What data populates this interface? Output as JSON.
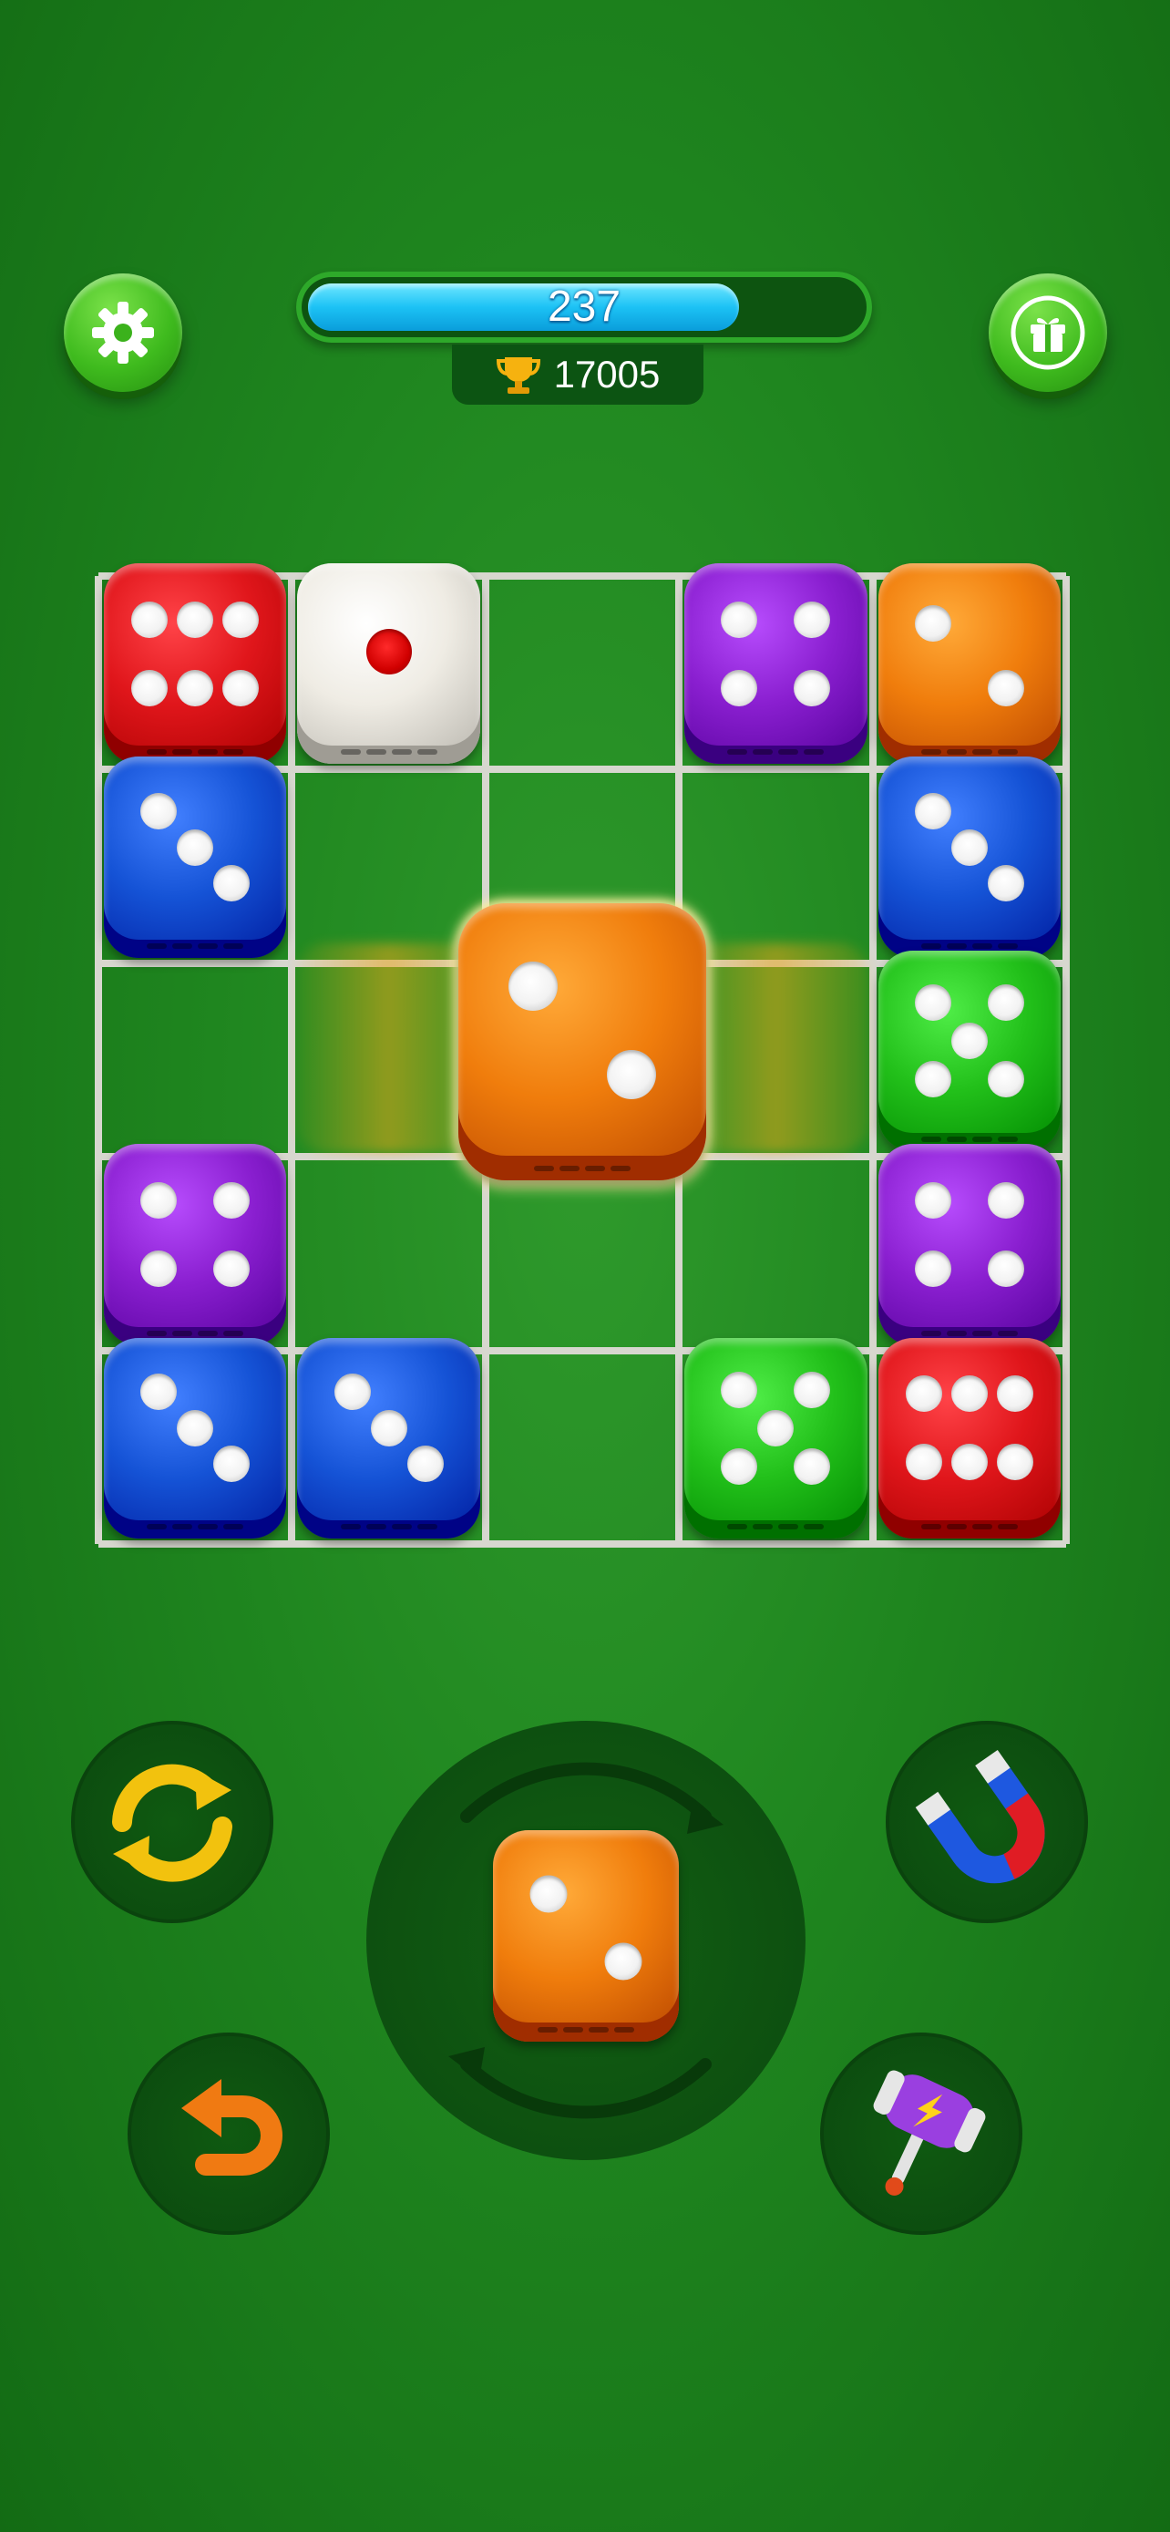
{
  "progress": {
    "value": "237",
    "fraction": 0.78
  },
  "score": {
    "value": "17005"
  },
  "colors": {
    "red": "#e0161b",
    "white": "#efece4",
    "purple": "#8a1fd0",
    "orange": "#f07d0c",
    "blue": "#1553d6",
    "green": "#22c01a"
  },
  "board": {
    "cells": [
      {
        "row": 0,
        "col": 0,
        "color": "red",
        "pips": 6
      },
      {
        "row": 0,
        "col": 1,
        "color": "white",
        "pips": 1
      },
      {
        "row": 0,
        "col": 3,
        "color": "purple",
        "pips": 4
      },
      {
        "row": 0,
        "col": 4,
        "color": "orange",
        "pips": 2
      },
      {
        "row": 1,
        "col": 0,
        "color": "blue",
        "pips": 3
      },
      {
        "row": 1,
        "col": 4,
        "color": "blue",
        "pips": 3
      },
      {
        "row": 2,
        "col": 4,
        "color": "green",
        "pips": 5
      },
      {
        "row": 3,
        "col": 0,
        "color": "purple",
        "pips": 4
      },
      {
        "row": 3,
        "col": 4,
        "color": "purple",
        "pips": 4
      },
      {
        "row": 4,
        "col": 0,
        "color": "blue",
        "pips": 3
      },
      {
        "row": 4,
        "col": 1,
        "color": "blue",
        "pips": 3
      },
      {
        "row": 4,
        "col": 3,
        "color": "green",
        "pips": 5
      },
      {
        "row": 4,
        "col": 4,
        "color": "red",
        "pips": 6
      }
    ],
    "dragging": {
      "row": 2,
      "col": 2,
      "color": "orange",
      "pips": 2
    }
  },
  "next_die": {
    "color": "orange",
    "pips": 2
  },
  "icons": {
    "settings": "gear-icon",
    "gift": "gift-icon",
    "trophy": "trophy-icon",
    "refresh": "refresh-icon",
    "magnet": "magnet-icon",
    "undo": "undo-icon",
    "hammer": "hammer-icon",
    "rotate": "rotate-arrows-icon"
  }
}
